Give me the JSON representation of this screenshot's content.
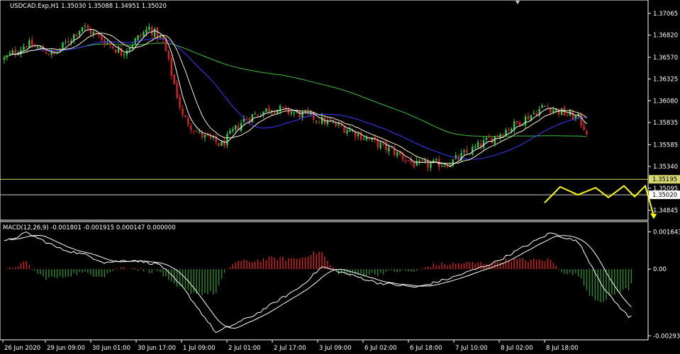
{
  "colors": {
    "background": "#000000",
    "frame": "#ffffff",
    "bull": "#2ecc40",
    "bear": "#e02020",
    "ma_fast": "#ffffff",
    "ma_mid": "#f5f0c0",
    "ma_slow": "#3a3aff",
    "ma_long": "#3cbf3c",
    "price_line": "#d8d870",
    "forecast": "#ffff00",
    "macd_pos": "#e02020",
    "macd_neg": "#2e8b2e",
    "macd_signal": "#ffffff"
  },
  "header": {
    "main": "USDCAD.Exp,H1  1.35030 1.35088 1.34951 1.35020",
    "macd": "MACD(12,26,9) -0.001801 -0.001915 0.000147 0.000000"
  },
  "icons": {
    "corner": "small-triangle-icon"
  },
  "chart_data": [
    {
      "type": "candlestick",
      "symbol": "USDCAD.Exp",
      "timeframe": "H1",
      "ylim": [
        1.3475,
        1.372
      ],
      "price_ticks": [
        1.37065,
        1.3682,
        1.3657,
        1.36325,
        1.3608,
        1.35835,
        1.35585,
        1.3534,
        1.35095,
        1.34845
      ],
      "marked_levels": [
        {
          "label": "1.35195",
          "value": 1.35195,
          "highlight": true
        },
        {
          "label": "1.35020",
          "value": 1.3502,
          "highlight": false
        }
      ],
      "time_labels": [
        "26 Jun 2020",
        "29 Jun 09:00",
        "30 Jun 01:00",
        "30 Jun 17:00",
        "1 Jul 09:00",
        "2 Jul 01:00",
        "2 Jul 17:00",
        "3 Jul 09:00",
        "6 Jul 02:00",
        "6 Jul 18:00",
        "7 Jul 10:00",
        "8 Jul 02:00",
        "8 Jul 18:00"
      ],
      "bars": 210,
      "path_points": [
        [
          0,
          1.3655
        ],
        [
          8,
          1.3672
        ],
        [
          18,
          1.366
        ],
        [
          28,
          1.3692
        ],
        [
          34,
          1.368
        ],
        [
          42,
          1.3662
        ],
        [
          52,
          1.369
        ],
        [
          57,
          1.3675
        ],
        [
          64,
          1.359
        ],
        [
          70,
          1.357
        ],
        [
          78,
          1.3558
        ],
        [
          86,
          1.3587
        ],
        [
          96,
          1.36
        ],
        [
          110,
          1.359
        ],
        [
          124,
          1.3575
        ],
        [
          140,
          1.355
        ],
        [
          148,
          1.3535
        ],
        [
          160,
          1.3538
        ],
        [
          180,
          1.3575
        ],
        [
          194,
          1.3602
        ],
        [
          206,
          1.3588
        ],
        [
          214,
          1.355
        ],
        [
          220,
          1.352
        ],
        [
          226,
          1.3512
        ],
        [
          230,
          1.3505
        ]
      ],
      "forecast_path": [
        1.3493,
        1.3511,
        1.3502,
        1.351,
        1.3499,
        1.3512,
        1.35,
        1.3512,
        1.3478
      ]
    },
    {
      "type": "macd",
      "params": [
        12,
        26,
        9
      ],
      "values": {
        "macd": -0.001801,
        "signal": -0.001915,
        "osma": 0.000147,
        "level": 0.0
      },
      "ylim": [
        -0.00305,
        0.002
      ],
      "ticks": [
        0.001643,
        0.0,
        -0.002934
      ],
      "tick_labels": [
        "0.001643",
        "0.00",
        "-0.002934"
      ],
      "path_points": [
        [
          0,
          0.0012
        ],
        [
          8,
          0.0016
        ],
        [
          20,
          0.0009
        ],
        [
          30,
          0.0006
        ],
        [
          36,
          0.0003
        ],
        [
          46,
          0.0004
        ],
        [
          56,
          0.0002
        ],
        [
          64,
          -0.0008
        ],
        [
          76,
          -0.0028
        ],
        [
          90,
          -0.002
        ],
        [
          106,
          -0.0008
        ],
        [
          114,
          0.0001
        ],
        [
          120,
          -0.0001
        ],
        [
          134,
          -0.0006
        ],
        [
          148,
          -0.0008
        ],
        [
          160,
          -0.0004
        ],
        [
          176,
          0.0003
        ],
        [
          196,
          0.0016
        ],
        [
          206,
          0.0012
        ],
        [
          216,
          -0.001
        ],
        [
          224,
          -0.0021
        ],
        [
          232,
          -0.002
        ]
      ]
    }
  ]
}
